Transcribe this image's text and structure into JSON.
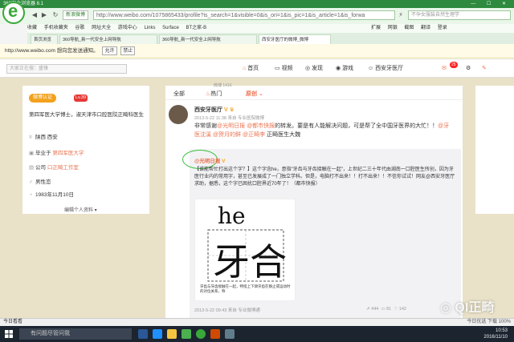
{
  "browser": {
    "title": "360安全浏览器 8.1",
    "mail_badge": "新浪微博",
    "url": "http://www.weibo.com/1075865433/profile?is_search=1&visible=0&is_ori=1&is_pic=1&is_article=1&is_forwa",
    "search_placeholder": "不孕女服装自然生理学",
    "bookmarks": [
      "收藏",
      "手机收藏夹",
      "谷歌",
      "网址大全",
      "游戏中心",
      "Links",
      "Surface",
      "BT之家-B"
    ],
    "bookmark_right": [
      "扩展",
      "网银",
      "截图",
      "翻译",
      "登录"
    ],
    "tabs": [
      "首页浏览",
      "360导航_新一代安全上网导航",
      "360导航_新一代安全上网导航",
      "西安牙医厅的微博_微博"
    ],
    "notify_text": "http://www.weibo.com 想向您发送通知。",
    "notify_allow": "允许",
    "notify_block": "禁止"
  },
  "weibo_nav": {
    "search_placeholder": "大家正在搜：盛锋",
    "items": [
      "首页",
      "视频",
      "发现",
      "游戏",
      "西安牙医厅"
    ],
    "badge": "25"
  },
  "profile": {
    "vip_label": "微博认证",
    "level": "Lv.39",
    "bio": "第四军医大学博士，淑天津市口腔医院正畸科医生",
    "location": "陕西 西安",
    "school_prefix": "毕业于",
    "school": "第四军医大学",
    "company_prefix": "公司",
    "company": "口正畸工作室",
    "gender": "男性恋",
    "birthday": "1983年11月10日",
    "edit_label": "编辑个人资料 ▾"
  },
  "feed": {
    "top_count": "微博 1416",
    "tabs": [
      "全部",
      "热门",
      "原创"
    ],
    "post": {
      "author": "西安牙医厅",
      "time": "2013-5-22 11:38 来自 专业医院微博",
      "text_a": "非常感谢",
      "mention_a": "@光明日报",
      "mention_b": "@都市快报",
      "text_b": "的转发。要是有人能解决问题，可是帮了全中国牙医界的大忙！！",
      "mention_c": "@牙医沈溪",
      "mention_d": "@贺月的鲜",
      "mention_e": "@正畸李",
      "text_c": "正畸医生大魏"
    },
    "repost": {
      "author": "@光明日报",
      "text": "【谁能帮忙打出这个字？】这个字念he，意指\"牙齿与牙齿接触在一起\"，上世纪二三十年代由湖南一口腔医生所创，因为牙医行业内的常用字，甚至已发展成了一门独立学科。但是，电脑打不出来！！打不出来！！不信你试试！网友@西安牙医厅 求助，据悉，这个字已困扰口腔界近70年了！（都市快报）",
      "image_pinyin": "he",
      "image_char": "牙合",
      "image_caption": "牙齿与牙齿接触在一起，特指上下颌牙齿在静止或运动时的对位关系，称",
      "meta": "2013-5-22 09:43 来自 专业微博通",
      "stats": [
        "444",
        "81",
        "142"
      ]
    }
  },
  "statusbar": {
    "left": "今日看看",
    "right": "今日优选 下载 100%"
  },
  "taskbar": {
    "search_placeholder": "有问题尽管问我",
    "time": "10:53",
    "date": "2016/11/10"
  },
  "watermark": "QI正畸"
}
